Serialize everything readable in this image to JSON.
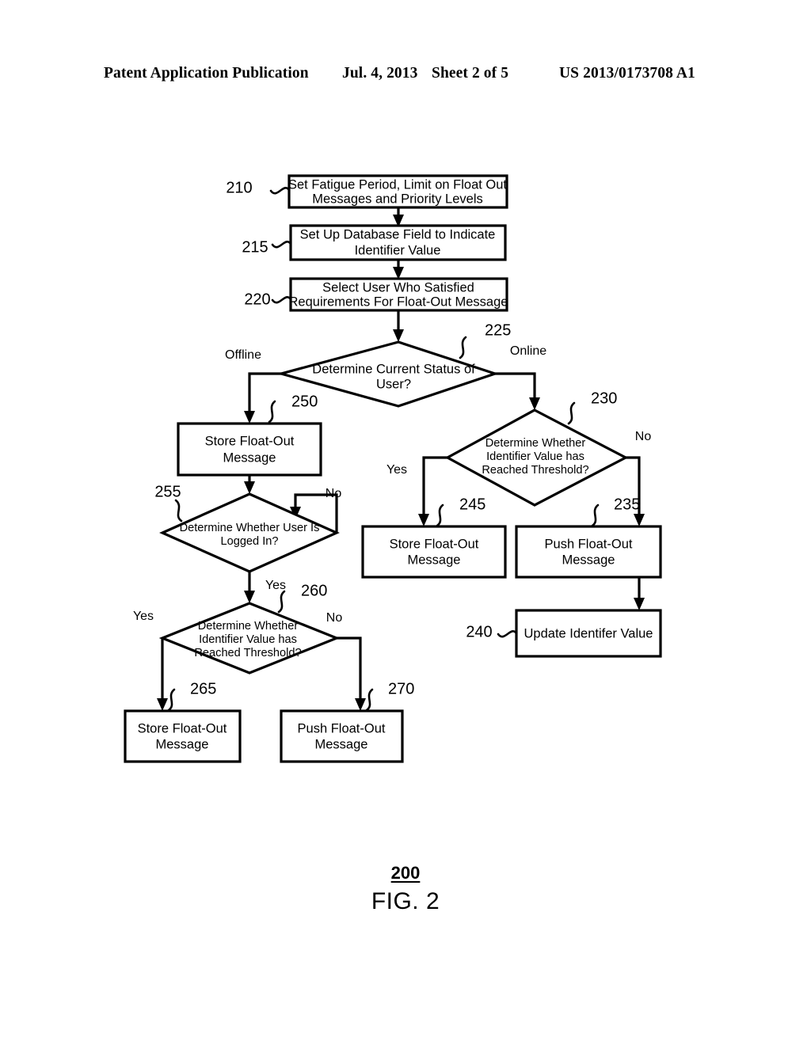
{
  "header": {
    "publication": "Patent Application Publication",
    "date": "Jul. 4, 2013",
    "sheet": "Sheet 2 of 5",
    "publication_number": "US 2013/0173708 A1"
  },
  "caption": {
    "reference_number": "200",
    "title": "FIG. 2"
  },
  "nodes": {
    "n210": {
      "ref": "210",
      "type": "process",
      "line1": "Set Fatigue Period, Limit on Float Out",
      "line2": "Messages and Priority Levels"
    },
    "n215": {
      "ref": "215",
      "type": "process",
      "line1": "Set Up Database Field to Indicate",
      "line2": "Identifier Value"
    },
    "n220": {
      "ref": "220",
      "type": "process",
      "line1": "Select User Who Satisfied",
      "line2": "Requirements For Float-Out Message"
    },
    "n225": {
      "ref": "225",
      "type": "decision",
      "line1": "Determine Current Status of",
      "line2": "User?"
    },
    "n230": {
      "ref": "230",
      "type": "decision",
      "line1": "Determine Whether",
      "line2": "Identifier Value has",
      "line3": "Reached Threshold?"
    },
    "n235": {
      "ref": "235",
      "type": "process",
      "line1": "Push Float-Out",
      "line2": "Message"
    },
    "n240": {
      "ref": "240",
      "type": "process",
      "line1": "Update Identifer Value"
    },
    "n245": {
      "ref": "245",
      "type": "process",
      "line1": "Store Float-Out",
      "line2": "Message"
    },
    "n250": {
      "ref": "250",
      "type": "process",
      "line1": "Store Float-Out",
      "line2": "Message"
    },
    "n255": {
      "ref": "255",
      "type": "decision",
      "line1": "Determine Whether User Is",
      "line2": "Logged In?"
    },
    "n260": {
      "ref": "260",
      "type": "decision",
      "line1": "Determine Whether",
      "line2": "Identifier Value has",
      "line3": "Reached Threshold?"
    },
    "n265": {
      "ref": "265",
      "type": "process",
      "line1": "Store Float-Out",
      "line2": "Message"
    },
    "n270": {
      "ref": "270",
      "type": "process",
      "line1": "Push Float-Out",
      "line2": "Message"
    }
  },
  "edge_labels": {
    "offline": "Offline",
    "online": "Online",
    "yes_230": "Yes",
    "no_230": "No",
    "no_255": "No",
    "yes_255": "Yes",
    "yes_260": "Yes",
    "no_260": "No"
  }
}
